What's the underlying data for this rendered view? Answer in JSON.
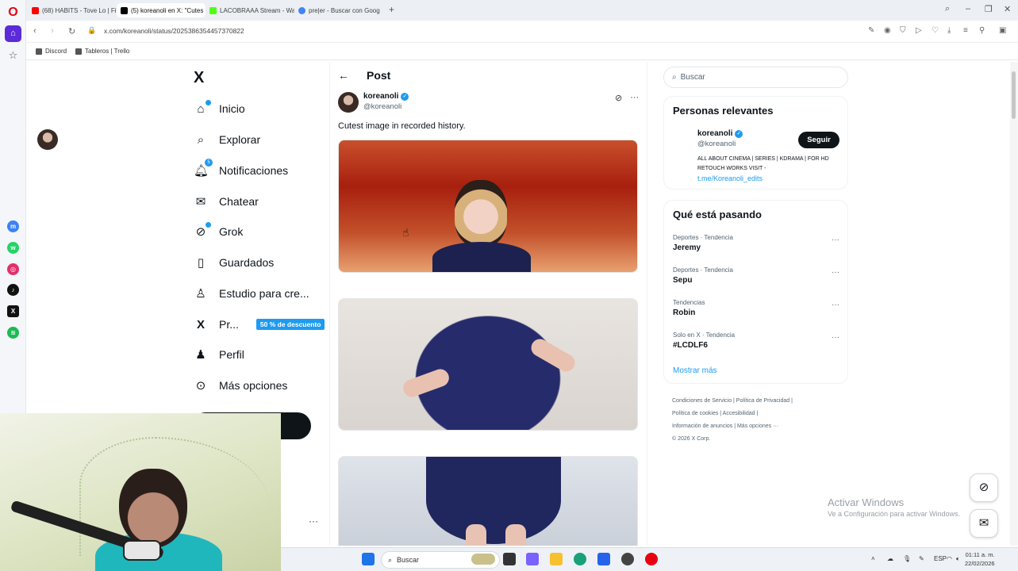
{
  "browser": {
    "tabs": [
      {
        "label": "(68) HABITS - Tove Lo | Fi",
        "color": "#ff0000"
      },
      {
        "label": "(5) koreanoli en X: \"Cutes",
        "color": "#000000"
      },
      {
        "label": "LACOBRAAA Stream - Wa",
        "color": "#53fc18"
      },
      {
        "label": "pre|er - Buscar con Goog",
        "color": "#4285f4"
      }
    ],
    "url": "x.com/koreanoli/status/2025386354457370822",
    "bookmarks": [
      "Discord",
      "Tableros | Trello"
    ]
  },
  "sidebar": {
    "logo": "X",
    "items": [
      {
        "label": "Inicio",
        "icon": "home-icon"
      },
      {
        "label": "Explorar",
        "icon": "search-icon"
      },
      {
        "label": "Notificaciones",
        "icon": "bell-icon",
        "badge": "5"
      },
      {
        "label": "Chatear",
        "icon": "mail-icon"
      },
      {
        "label": "Grok",
        "icon": "grok-icon"
      },
      {
        "label": "Guardados",
        "icon": "bookmark-icon"
      },
      {
        "label": "Estudio para cre...",
        "icon": "studio-icon"
      },
      {
        "label": "Pr...",
        "icon": "x-premium-icon",
        "promo": "50 % de descuento"
      },
      {
        "label": "Perfil",
        "icon": "person-icon"
      },
      {
        "label": "Más opciones",
        "icon": "more-circle-icon"
      }
    ],
    "more_dots": "···"
  },
  "post": {
    "header": "Post",
    "author_name": "koreanoli",
    "author_handle": "@koreanoli",
    "text": "Cutest image in recorded history."
  },
  "right": {
    "search_placeholder": "Buscar",
    "relevant_title": "Personas relevantes",
    "relevant": {
      "name": "koreanoli",
      "handle": "@koreanoli",
      "follow": "Seguir",
      "bio": "ALL ABOUT CINEMA | SERIES | KDRAMA | FOR HD RETOUCH WORKS VISIT -",
      "link": "t.me/Koreanoli_edits"
    },
    "trends_title": "Qué está pasando",
    "trends": [
      {
        "category": "Deportes · Tendencia",
        "title": "Jeremy"
      },
      {
        "category": "Deportes · Tendencia",
        "title": "Sepu"
      },
      {
        "category": "Tendencias",
        "title": "Robin"
      },
      {
        "category": "Solo en X · Tendencia",
        "title": "#LCDLF6"
      }
    ],
    "show_more": "Mostrar más",
    "footer": {
      "line1": "Condiciones de Servicio  |   Política de Privacidad  |",
      "line2": "Política de cookies  |   Accesibilidad  |",
      "line3": "Información de anuncios  |   Más opciones ···",
      "line4": "© 2026 X Corp."
    }
  },
  "activate": {
    "line1": "Activar Windows",
    "line2": "Ve a Configuración para activar Windows."
  },
  "taskbar": {
    "search": "Buscar",
    "lang": "ESP",
    "time": "01:11 a. m.",
    "date": "22/02/2026"
  },
  "colors": {
    "accent": "#1d9bf0",
    "text": "#0f1419",
    "muted": "#536471"
  }
}
